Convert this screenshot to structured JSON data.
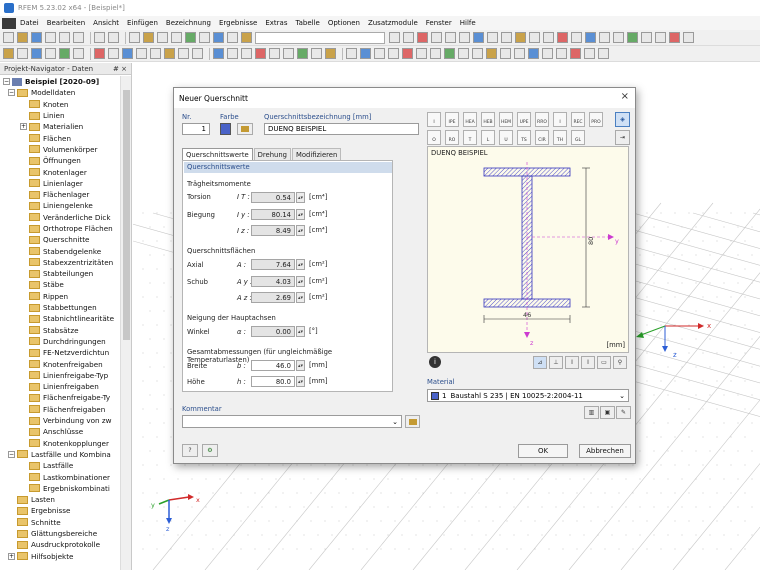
{
  "window": {
    "title": "RFEM 5.23.02 x64 - [Beispiel*]"
  },
  "menu": [
    "Datei",
    "Bearbeiten",
    "Ansicht",
    "Einfügen",
    "Bezeichnung",
    "Ergebnisse",
    "Extras",
    "Tabelle",
    "Optionen",
    "Zusatzmodule",
    "Fenster",
    "Hilfe"
  ],
  "navigator": {
    "title": "Projekt-Navigator - Daten",
    "pin": "# ×",
    "root": "Beispiel [2020-09]",
    "items": [
      "Modelldaten",
      "Knoten",
      "Linien",
      "Materialien",
      "Flächen",
      "Volumenkörper",
      "Öffnungen",
      "Knotenlager",
      "Linienlager",
      "Flächenlager",
      "Liniengelenke",
      "Veränderliche Dick",
      "Orthotrope Flächen",
      "Querschnitte",
      "Stabendgelenke",
      "Stabexzentrizitäten",
      "Stabteilungen",
      "Stäbe",
      "Rippen",
      "Stabbettungen",
      "Stabnichtlinearitäte",
      "Stabsätze",
      "Durchdringungen",
      "FE-Netzverdichtun",
      "Knotenfreigaben",
      "Linienfreigabe-Typ",
      "Linienfreigaben",
      "Flächenfreigabe-Ty",
      "Flächenfreigaben",
      "Verbindung von zw",
      "Anschlüsse",
      "Knotenkopplunger",
      "Lastfälle und Kombina",
      "Lastfälle",
      "Lastkombinationer",
      "Ergebniskombinati",
      "Lasten",
      "Ergebnisse",
      "Schnitte",
      "Glättungsbereiche",
      "Ausdruckprotokolle",
      "Hilfsobjekte"
    ]
  },
  "dialog": {
    "title": "Neuer Querschnitt",
    "close": "×",
    "nr_label": "Nr.",
    "nr_value": "1",
    "color_label": "Farbe",
    "name_label": "Querschnittsbezeichnung [mm]",
    "name_value": "DUENQ BEISPIEL",
    "tabs": [
      "Querschnittswerte",
      "Drehung",
      "Modifizieren"
    ],
    "section_header": "Querschnittswerte",
    "inertia_head": "Trägheitsmomente",
    "torsion_label": "Torsion",
    "torsion_sym": "I T :",
    "torsion_val": "0.54",
    "torsion_unit": "[cm⁴]",
    "bending_label": "Biegung",
    "iy_sym": "I y :",
    "iy_val": "80.14",
    "iy_unit": "[cm⁴]",
    "iz_sym": "I z :",
    "iz_val": "8.49",
    "iz_unit": "[cm⁴]",
    "areas_head": "Querschnittsflächen",
    "axial_label": "Axial",
    "a_sym": "A :",
    "a_val": "7.64",
    "a_unit": "[cm²]",
    "shear_label": "Schub",
    "ay_sym": "A y :",
    "ay_val": "4.03",
    "ay_unit": "[cm²]",
    "az_sym": "A z :",
    "az_val": "2.69",
    "az_unit": "[cm²]",
    "incl_head": "Neigung der Hauptachsen",
    "angle_label": "Winkel",
    "angle_sym": "α :",
    "angle_val": "0.00",
    "angle_unit": "[°]",
    "dims_head": "Gesamtabmessungen (für ungleichmäßige Temperaturlasten)",
    "width_label": "Breite",
    "width_sym": "b :",
    "width_val": "46.0",
    "width_unit": "[mm]",
    "height_label": "Höhe",
    "height_sym": "h :",
    "height_val": "80.0",
    "height_unit": "[mm]",
    "comment_label": "Kommentar",
    "preview_title": "DUENQ BEISPIEL",
    "dim_h": "80",
    "dim_b": "46",
    "axis_y": "y",
    "axis_z": "z",
    "unit_mm": "[mm]",
    "material_label": "Material",
    "material_nr": "1",
    "material_value": "Baustahl S 235 | EN 10025-2:2004-11",
    "ok": "OK",
    "cancel": "Abbrechen",
    "section_types": [
      "I",
      "IPE",
      "HEA",
      "HEB",
      "HEM",
      "UPE",
      "RRO",
      "I",
      "REC",
      "PRO",
      "O",
      "RO",
      "T",
      "L",
      "U",
      "TS",
      "CIR",
      "TH",
      "GL"
    ]
  },
  "viewport": {
    "axis_x": "x",
    "axis_y": "y",
    "axis_z": "z"
  }
}
